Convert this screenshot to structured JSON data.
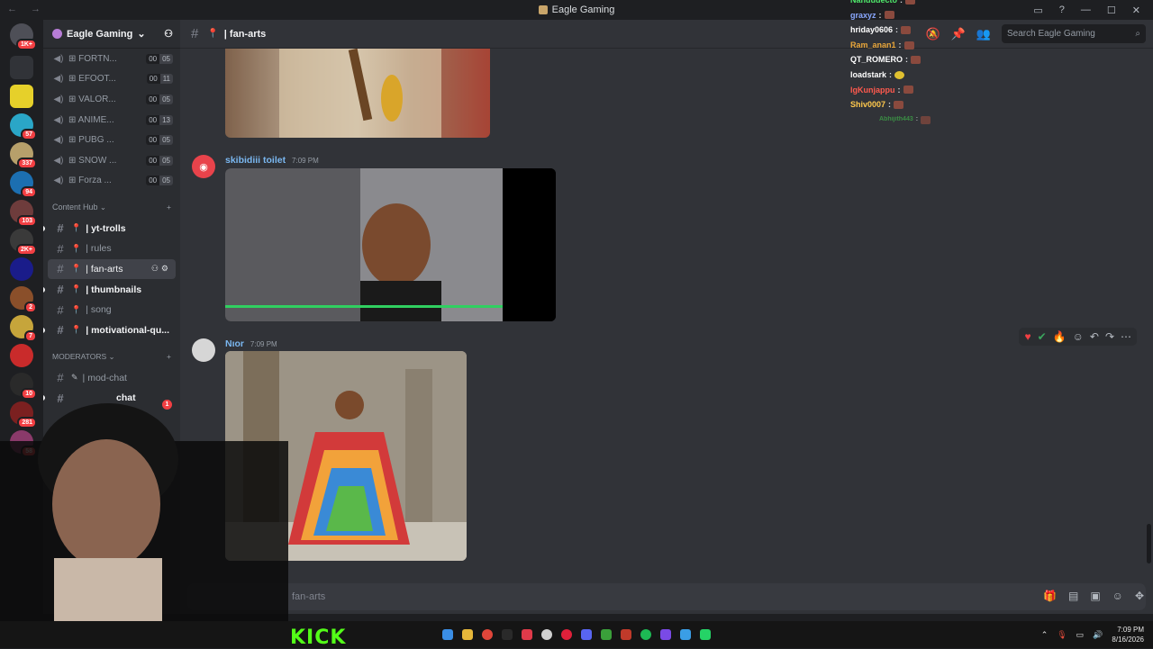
{
  "window": {
    "title": "Eagle Gaming"
  },
  "server": {
    "name": "Eagle Gaming"
  },
  "guild_badges": [
    "1K+",
    "",
    "",
    "57",
    "337",
    "94",
    "103",
    "2K+",
    "",
    "2",
    "7",
    "",
    "10",
    "281",
    "58"
  ],
  "voice_channels": [
    {
      "name": "⊞ FORTN...",
      "count_a": "00",
      "count_b": "05"
    },
    {
      "name": "⊞ EFOOT...",
      "count_a": "00",
      "count_b": "11"
    },
    {
      "name": "⊞ VALOR...",
      "count_a": "00",
      "count_b": "05"
    },
    {
      "name": "⊞ ANIME...",
      "count_a": "00",
      "count_b": "13"
    },
    {
      "name": "⊞ PUBG ...",
      "count_a": "00",
      "count_b": "05"
    },
    {
      "name": "⊞ SNOW ...",
      "count_a": "00",
      "count_b": "05"
    },
    {
      "name": "⊞ Forza ...",
      "count_a": "00",
      "count_b": "05"
    }
  ],
  "categories": {
    "content_hub": "Content Hub",
    "moderators": "MODERATORS"
  },
  "content_channels": [
    "| yt-trolls",
    "| rules",
    "| fan-arts",
    "| thumbnails",
    "| song",
    "| motivational-qu..."
  ],
  "mod_channels": [
    "| mod-chat",
    "chat"
  ],
  "mod_unread": "1",
  "channel_header": {
    "name": "| fan-arts"
  },
  "search": {
    "placeholder": "Search Eagle Gaming"
  },
  "messages": [
    {
      "author": "skibidiii toilet",
      "time": "7:09 PM"
    },
    {
      "author": "Nıor",
      "time": "7:09 PM"
    }
  ],
  "composer": {
    "placeholder": "fan-arts"
  },
  "stream_chat": [
    {
      "user": "Nandudecto",
      "color": "#4ee86a"
    },
    {
      "user": "graxyz",
      "color": "#8aa8ff"
    },
    {
      "user": "hriday0606",
      "color": "#ffffff"
    },
    {
      "user": "Ram_anan1",
      "color": "#e8a63a"
    },
    {
      "user": "QT_ROMERO",
      "color": "#ffffff"
    },
    {
      "user": "loadstark",
      "color": "#ffffff"
    },
    {
      "user": "lgKunjappu",
      "color": "#ff5a4e"
    },
    {
      "user": "Shiv0007",
      "color": "#ffc94d"
    },
    {
      "user": "Abhijith443",
      "color": "#3fb34a"
    }
  ],
  "taskbar": {
    "brand": "KICK",
    "time": "7:09 PM",
    "date": "8/16/2026"
  },
  "colors": {
    "accent": "#5865f2",
    "danger": "#f23f43",
    "kick": "#53fc18"
  }
}
